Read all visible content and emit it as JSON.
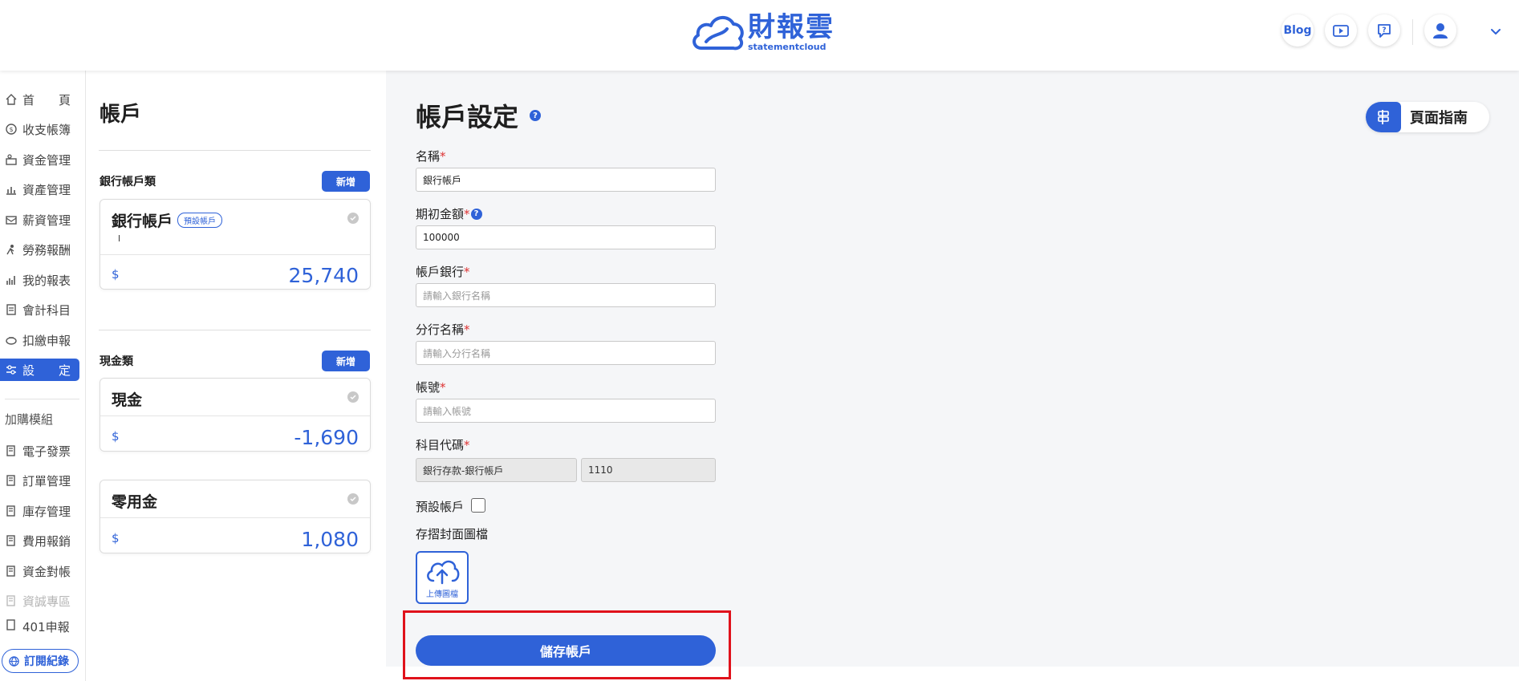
{
  "header": {
    "logo_cn": "財報雲",
    "logo_en": "statementcloud",
    "blog_label": "Blog"
  },
  "sidebar": {
    "items": [
      {
        "label": "首　　頁",
        "icon": "home-icon"
      },
      {
        "label": "收支帳簿",
        "icon": "coin-icon"
      },
      {
        "label": "資金管理",
        "icon": "fund-icon"
      },
      {
        "label": "資產管理",
        "icon": "asset-icon"
      },
      {
        "label": "薪資管理",
        "icon": "salary-icon"
      },
      {
        "label": "勞務報酬",
        "icon": "labor-icon"
      },
      {
        "label": "我的報表",
        "icon": "report-icon"
      },
      {
        "label": "會計科目",
        "icon": "ledger-icon"
      },
      {
        "label": "扣繳申報",
        "icon": "tax-icon"
      },
      {
        "label": "設　　定",
        "icon": "settings-icon"
      }
    ],
    "addon_title": "加購模組",
    "addons": [
      {
        "label": "電子發票"
      },
      {
        "label": "訂單管理"
      },
      {
        "label": "庫存管理"
      },
      {
        "label": "費用報銷"
      },
      {
        "label": "資金對帳"
      },
      {
        "label": "資誠專區"
      },
      {
        "label": "401申報"
      }
    ],
    "subscription_label": "訂閱紀錄"
  },
  "accounts": {
    "title": "帳戶",
    "bank_category": "銀行帳戶類",
    "cash_category": "現金類",
    "add_label": "新增",
    "currency": "$",
    "bank_cards": [
      {
        "name": "銀行帳戶",
        "tag": "預設帳戶",
        "note": "l",
        "amount": "25,740"
      }
    ],
    "cash_cards": [
      {
        "name": "現金",
        "amount": "-1,690"
      },
      {
        "name": "零用金",
        "amount": "1,080"
      }
    ]
  },
  "form": {
    "title": "帳戶設定",
    "help_mark": "?",
    "guide_label": "頁面指南",
    "name_label": "名稱",
    "name_value": "銀行帳戶",
    "opening_label": "期初金額",
    "opening_value": "100000",
    "bank_label": "帳戶銀行",
    "bank_placeholder": "請輸入銀行名稱",
    "branch_label": "分行名稱",
    "branch_placeholder": "請輸入分行名稱",
    "number_label": "帳號",
    "number_placeholder": "請輸入帳號",
    "code_label": "科目代碼",
    "code_name": "銀行存款-銀行帳戶",
    "code_value": "1110",
    "default_label": "預設帳戶",
    "cover_label": "存摺封面圖檔",
    "upload_label": "上傳圖檔",
    "save_label": "儲存帳戶",
    "required_mark": "*"
  },
  "colors": {
    "accent": "#2f62d8",
    "required": "#dd3333",
    "highlight": "#e0121b"
  }
}
